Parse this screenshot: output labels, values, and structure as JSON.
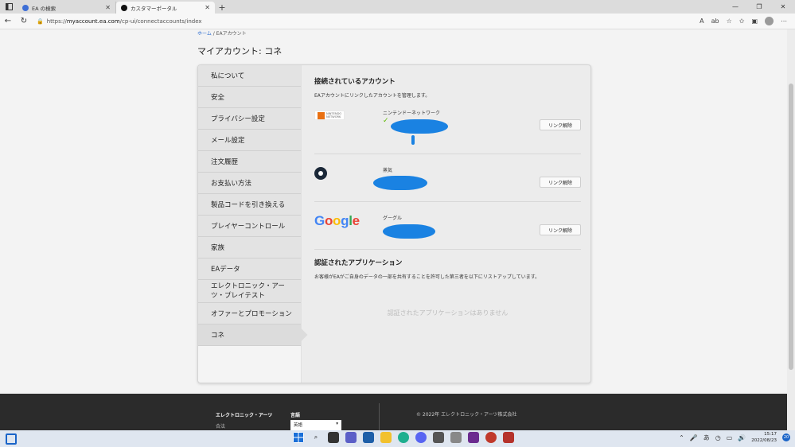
{
  "browser": {
    "tabs": [
      {
        "title": "EA の検索",
        "favicon_color": "#3d6ed6"
      },
      {
        "title": "カスタマーポータル",
        "favicon_color": "#111111"
      }
    ],
    "new_tab_glyph": "+",
    "url_scheme": "https://",
    "url_host": "myaccount.ea.com",
    "url_path": "/cp-ui/connectaccounts/index",
    "window_controls": [
      "—",
      "❐",
      "✕"
    ]
  },
  "page": {
    "breadcrumb_home": "ホーム",
    "breadcrumb_sep": " / ",
    "breadcrumb_current": "EAアカウント",
    "title": "マイアカウント: コネ"
  },
  "sidebar": {
    "items": [
      {
        "label": "私について"
      },
      {
        "label": "安全"
      },
      {
        "label": "プライバシー設定"
      },
      {
        "label": "メール設定"
      },
      {
        "label": "注文履歴"
      },
      {
        "label": "お支払い方法"
      },
      {
        "label": "製品コードを引き換える"
      },
      {
        "label": "プレイヤーコントロール"
      },
      {
        "label": "家族"
      },
      {
        "label": "EAデータ"
      },
      {
        "label": "エレクトロニック・アーツ・プレイテスト"
      },
      {
        "label": "オファーとプロモーション"
      },
      {
        "label": "コネ"
      }
    ]
  },
  "connected": {
    "title": "接続されているアカウント",
    "description": "EAアカウントにリンクしたアカウントを管理します。",
    "accounts": [
      {
        "name": "ニンテンドーネットワーク",
        "unlink_label": "リンク解除",
        "logo_line1": "NINTENDO",
        "logo_line2": "NETWORK"
      },
      {
        "name": "蒸気",
        "unlink_label": "リンク解除"
      },
      {
        "name": "グーグル",
        "unlink_label": "リンク解除",
        "logo_text": "Google"
      }
    ],
    "check_glyph": "✓"
  },
  "apps": {
    "title": "認証されたアプリケーション",
    "description": "お客様がEAがご自身のデータの一部を共有することを許可した第三者を以下にリストアップしています。",
    "empty": "認証されたアプリケーションはありません"
  },
  "footer": {
    "brand": "エレクトロニック・アーツ",
    "brand_sub": "合法",
    "lang_heading": "言語",
    "lang_value": "英語",
    "copyright": "© 2022年 エレクトロニック・アーツ株式会社"
  },
  "taskbar": {
    "time": "15:17",
    "date": "2022/08/23",
    "ime": "あ",
    "notifications": "20"
  },
  "colors": {
    "google_blue": "#4285F4",
    "google_red": "#EA4335",
    "google_yellow": "#FBBC05",
    "google_green": "#34A853",
    "redaction": "#1a82e2"
  }
}
